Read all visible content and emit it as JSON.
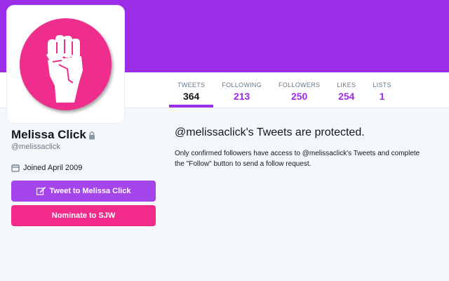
{
  "colors": {
    "accent": "#9b2de8",
    "avatar_pink": "#ef2d8c",
    "tweet_button": "#a546ec",
    "nominate_button": "#f22b8b"
  },
  "profile": {
    "name": "Melissa Click",
    "handle": "@melissaclick",
    "joined": "Joined April 2009",
    "protected_icon": "lock-icon",
    "joined_icon": "calendar-icon",
    "avatar_icon": "raised-fist-icon"
  },
  "nav": [
    {
      "label": "TWEETS",
      "value": "364"
    },
    {
      "label": "FOLLOWING",
      "value": "213"
    },
    {
      "label": "FOLLOWERS",
      "value": "250"
    },
    {
      "label": "LIKES",
      "value": "254"
    },
    {
      "label": "LISTS",
      "value": "1"
    }
  ],
  "buttons": {
    "tweet_to": "Tweet to Melissa Click",
    "nominate": "Nominate to SJW",
    "tweet_icon": "compose-icon"
  },
  "protected": {
    "title": "@melissaclick's Tweets are protected.",
    "line1": "Only confirmed followers have access to @melissaclick's Tweets and complete",
    "line2": "the \"Follow\" button to send a follow request."
  }
}
